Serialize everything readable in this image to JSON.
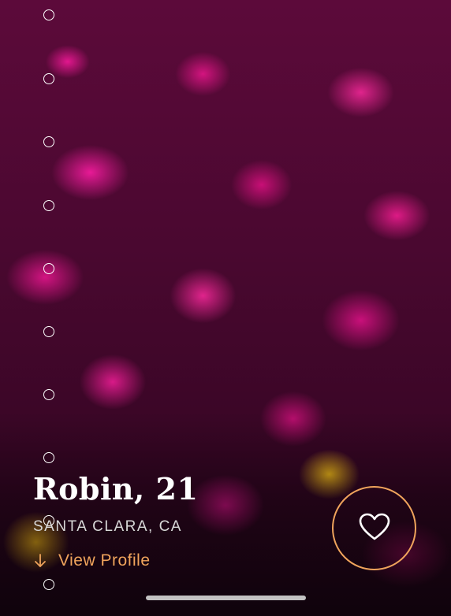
{
  "profile": {
    "name_age": "Robin, 21",
    "location": "SANTA CLARA, CA",
    "view_profile_label": "View Profile"
  },
  "photo_indicator": {
    "total": 10,
    "current": 0
  },
  "icons": {
    "view_profile": "arrow-down-icon",
    "like": "heart-icon"
  },
  "colors": {
    "accent": "#f0a45c",
    "text_primary": "#ffffff",
    "text_secondary": "#d8d8d8"
  }
}
